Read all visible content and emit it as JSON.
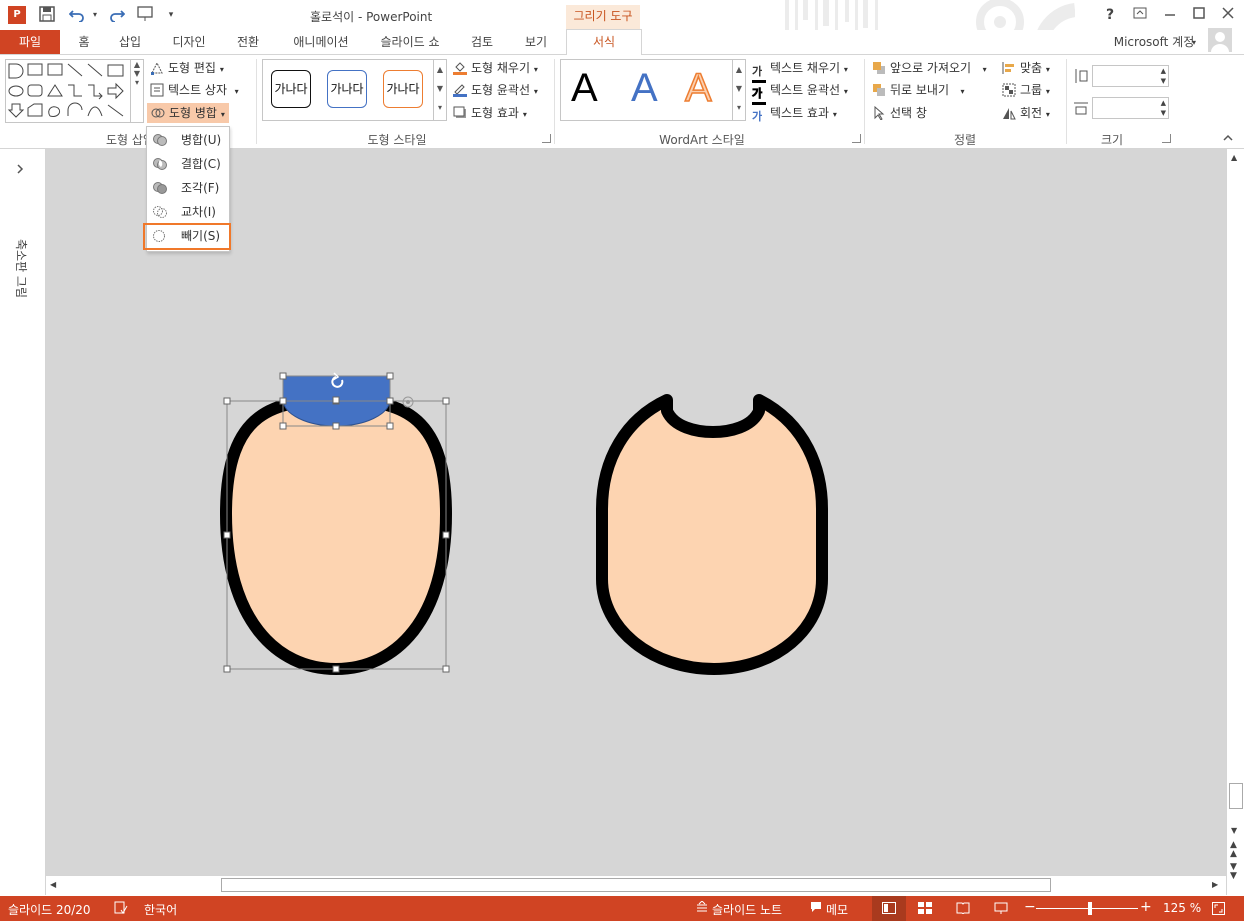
{
  "window": {
    "title": "홀로석이 - PowerPoint",
    "context_tab_group": "그리기 도구",
    "help": "?",
    "account": "Microsoft 계정"
  },
  "tabs": [
    {
      "label": "파일"
    },
    {
      "label": "홈"
    },
    {
      "label": "삽입"
    },
    {
      "label": "디자인"
    },
    {
      "label": "전환"
    },
    {
      "label": "애니메이션"
    },
    {
      "label": "슬라이드 쇼"
    },
    {
      "label": "검토"
    },
    {
      "label": "보기"
    },
    {
      "label": "서식"
    }
  ],
  "ribbon": {
    "insert_shapes": {
      "label": "도형 삽입",
      "edit_shape": "도형 편집",
      "text_box": "텍스트 상자",
      "merge_shapes": "도형 병합"
    },
    "shape_styles": {
      "label": "도형 스타일",
      "sample_text": "가나다",
      "fill": "도형 채우기",
      "outline": "도형 윤곽선",
      "effects": "도형 효과"
    },
    "wordart": {
      "label": "WordArt 스타일",
      "letter": "A",
      "fill_icon_text": "가",
      "text_fill": "텍스트 채우기",
      "text_outline": "텍스트 윤곽선",
      "text_effects": "텍스트 효과"
    },
    "arrange": {
      "label": "정렬",
      "bring_forward": "앞으로 가져오기",
      "send_backward": "뒤로 보내기",
      "selection_pane": "선택 창",
      "align": "맞춤",
      "group": "그룹",
      "rotate": "회전"
    },
    "size": {
      "label": "크기",
      "height_value": "",
      "width_value": ""
    }
  },
  "merge_menu": [
    {
      "label": "병합(U)"
    },
    {
      "label": "결합(C)"
    },
    {
      "label": "조각(F)"
    },
    {
      "label": "교차(I)"
    },
    {
      "label": "빼기(S)"
    }
  ],
  "left_pane": {
    "label": "축소판 그림"
  },
  "status": {
    "slide": "슬라이드 20/20",
    "language": "한국어",
    "notes": "슬라이드 노트",
    "comments": "메모",
    "zoom": "125 %"
  },
  "colors": {
    "accent": "#d04423",
    "face_fill": "#fdd4b1",
    "outline": "#000000",
    "selection_fill": "#4472c4",
    "highlight": "#f0782a",
    "canvas": "#d6d6d6"
  }
}
